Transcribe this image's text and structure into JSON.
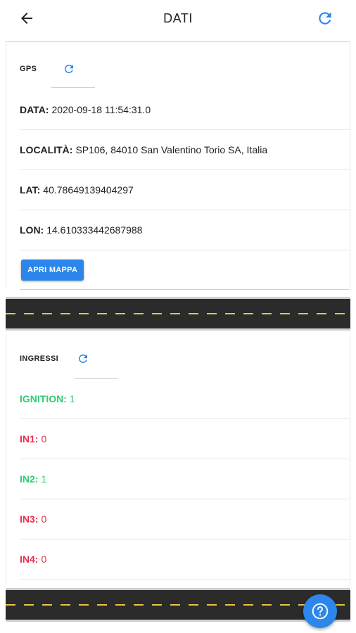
{
  "header": {
    "title": "DATI"
  },
  "gps": {
    "section_label": "GPS",
    "rows": [
      {
        "key": "DATA:",
        "value": "2020-09-18 11:54:31.0"
      },
      {
        "key": "LOCALITÀ:",
        "value": "SP106, 84010 San Valentino Torio SA, Italia"
      },
      {
        "key": "LAT:",
        "value": "40.78649139404297"
      },
      {
        "key": "LON:",
        "value": "14.610333442687988"
      }
    ],
    "map_button": "APRI MAPPA"
  },
  "inputs": {
    "section_label": "INGRESSI",
    "rows": [
      {
        "key": "IGNITION:",
        "value": "1",
        "state": "on"
      },
      {
        "key": "IN1:",
        "value": "0",
        "state": "off"
      },
      {
        "key": "IN2:",
        "value": "1",
        "state": "on"
      },
      {
        "key": "IN3:",
        "value": "0",
        "state": "off"
      },
      {
        "key": "IN4:",
        "value": "0",
        "state": "off"
      }
    ]
  },
  "colors": {
    "accent": "#2b85ea",
    "on": "#2ecc71",
    "off": "#e8304f"
  },
  "icons": {
    "back": "arrow-left-icon",
    "refresh": "refresh-icon",
    "help": "help-icon"
  }
}
